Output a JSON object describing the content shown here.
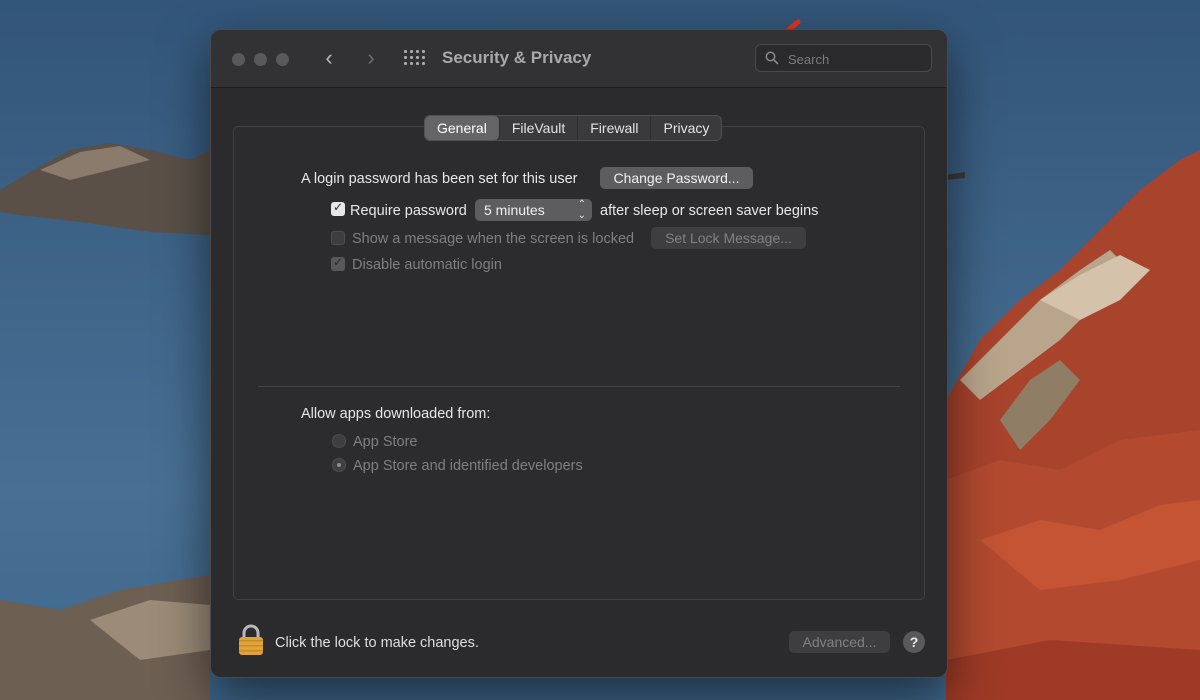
{
  "window": {
    "title": "Security & Privacy",
    "search_placeholder": "Search"
  },
  "tabs": [
    {
      "label": "General",
      "active": true
    },
    {
      "label": "FileVault",
      "active": false
    },
    {
      "label": "Firewall",
      "active": false
    },
    {
      "label": "Privacy",
      "active": false
    }
  ],
  "general": {
    "login_password_text": "A login password has been set for this user",
    "change_password_label": "Change Password...",
    "require_password_label": "Require password",
    "require_password_checked": true,
    "require_password_delay": "5 minutes",
    "require_password_suffix": "after sleep or screen saver begins",
    "show_message_label": "Show a message when the screen is locked",
    "show_message_checked": false,
    "set_lock_message_label": "Set Lock Message...",
    "disable_auto_login_label": "Disable automatic login",
    "disable_auto_login_checked": true,
    "allow_apps_heading": "Allow apps downloaded from:",
    "allow_apps_options": [
      {
        "label": "App Store",
        "selected": false
      },
      {
        "label": "App Store and identified developers",
        "selected": true
      }
    ]
  },
  "footer": {
    "lock_text": "Click the lock to make changes.",
    "advanced_label": "Advanced...",
    "help_label": "?"
  },
  "colors": {
    "annotation_arrow": "#e8321f",
    "window_bg": "#2b2b2d",
    "lock_gold": "#e0a23a"
  }
}
